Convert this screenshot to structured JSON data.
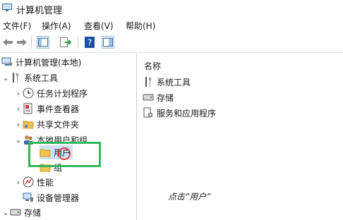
{
  "window": {
    "title": "计算机管理"
  },
  "menu": [
    {
      "label": "文件(F)"
    },
    {
      "label": "操作(A)"
    },
    {
      "label": "查看(V)"
    },
    {
      "label": "帮助(H)"
    }
  ],
  "toolbar": {
    "icons": [
      "back-arrow-icon",
      "forward-arrow-icon",
      "show-hide-tree-icon",
      "export-list-icon",
      "help-icon",
      "properties-icon"
    ]
  },
  "tree": {
    "root": {
      "label": "计算机管理(本地)"
    },
    "system_tools": {
      "label": "系统工具"
    },
    "task_scheduler": {
      "label": "任务计划程序"
    },
    "event_viewer": {
      "label": "事件查看器"
    },
    "shared_folders": {
      "label": "共享文件夹"
    },
    "local_users_groups": {
      "label": "本地用户和组"
    },
    "users": {
      "label": "用户"
    },
    "groups": {
      "label": "组"
    },
    "performance": {
      "label": "性能"
    },
    "device_manager": {
      "label": "设备管理器"
    },
    "storage": {
      "label": "存储"
    }
  },
  "list": {
    "header": "名称",
    "items": [
      {
        "label": "系统工具",
        "icon": "system-tools-icon"
      },
      {
        "label": "存储",
        "icon": "storage-icon"
      },
      {
        "label": "服务和应用程序",
        "icon": "services-apps-icon"
      }
    ]
  },
  "caption": "点击“用户”",
  "colors": {
    "highlight": "#2eb85c",
    "click": "#e04040",
    "folder": "#f2c24f"
  }
}
